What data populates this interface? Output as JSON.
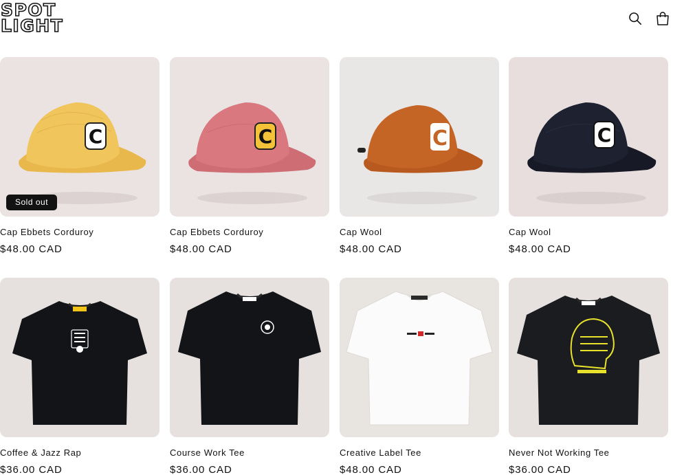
{
  "store": {
    "logo_line1": "SPOT",
    "logo_line2": "LIGHT"
  },
  "header": {
    "icons": [
      "search-icon",
      "cart-icon"
    ]
  },
  "products": [
    {
      "title": "Cap Ebbets Corduroy",
      "price": "$48.00 CAD",
      "badge": "Sold out",
      "color": "#f0c55c"
    },
    {
      "title": "Cap Ebbets Corduroy",
      "price": "$48.00 CAD",
      "badge": "",
      "color": "#d9787f"
    },
    {
      "title": "Cap Wool",
      "price": "$48.00 CAD",
      "badge": "",
      "color": "#c46425"
    },
    {
      "title": "Cap Wool",
      "price": "$48.00 CAD",
      "badge": "",
      "color": "#1e2230"
    },
    {
      "title": "Coffee & Jazz Rap",
      "price": "$36.00 CAD",
      "badge": "",
      "color": "#121418"
    },
    {
      "title": "Course Work Tee",
      "price": "$36.00 CAD",
      "badge": "",
      "color": "#121418"
    },
    {
      "title": "Creative Label Tee",
      "price": "$48.00 CAD",
      "badge": "",
      "color": "#fbfbfb"
    },
    {
      "title": "Never Not Working Tee",
      "price": "$36.00 CAD",
      "badge": "",
      "color": "#1a1c20"
    }
  ]
}
